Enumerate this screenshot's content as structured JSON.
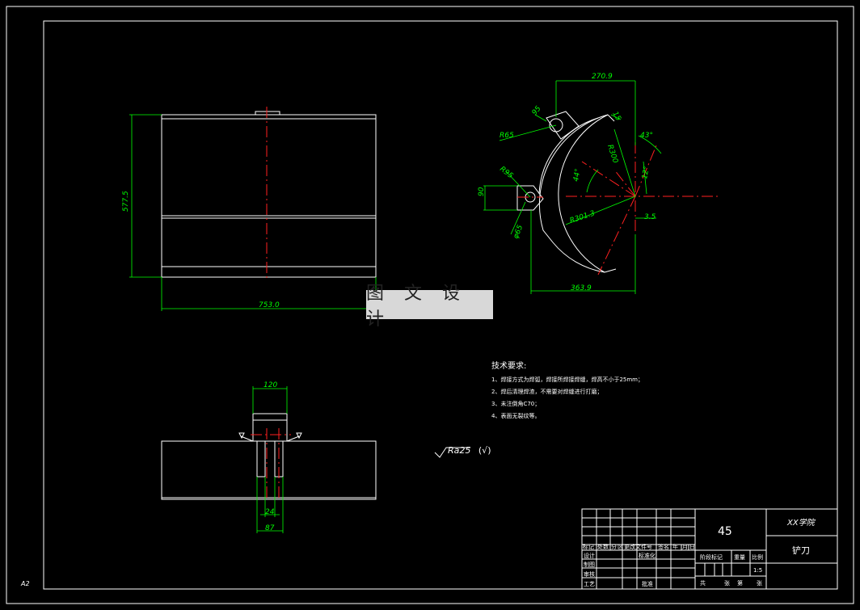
{
  "dimensions": {
    "front_height": "577.5",
    "front_width": "753.0",
    "top_width": "270.9",
    "r95_top": "95",
    "r_top_left": "R65",
    "r_left": "R95",
    "left_90": "90",
    "left_dia": "φ65",
    "r_arc": "R301.3",
    "right_35": "3.5",
    "bottom_width": "363.9",
    "angle_43": "43°",
    "angle_44": "44°",
    "angle_12": "12°",
    "small_15": "15",
    "r300": "R300",
    "slot_top": "120",
    "slot_inner": "24",
    "slot_outer": "87"
  },
  "watermark": "图 文 设 计",
  "notes": {
    "title": "技术要求:",
    "items": [
      "1、焊接方式为焊弧，焊接所焊接焊缝，焊高不小于25mm；",
      "2、焊后清理焊渣，不需要对焊缝进行打磨；",
      "3、未注倒角C70；",
      "4、表面无裂纹等。"
    ]
  },
  "roughness": {
    "value": "Ra25",
    "suffix": "(√)"
  },
  "title_block": {
    "material": "45",
    "school": "XX学院",
    "part_name": "铲刀",
    "scale": "1:5",
    "headers": [
      "标记",
      "处数",
      "分",
      "区",
      "更改文件号",
      "签名",
      "年",
      "月",
      "日"
    ],
    "rows": [
      "设计",
      "制图",
      "审核",
      "工艺"
    ],
    "standard": "标准化",
    "approve": "批准",
    "stage": "阶段标记",
    "weight": "重量",
    "ratio": "比例",
    "sheets": [
      "共",
      "张",
      "第",
      "张"
    ]
  },
  "sheet_label": "A2",
  "colors": {
    "background": "#000000",
    "line": "#ffffff",
    "dimension": "#00ff00",
    "centerline": "#ff2020"
  }
}
